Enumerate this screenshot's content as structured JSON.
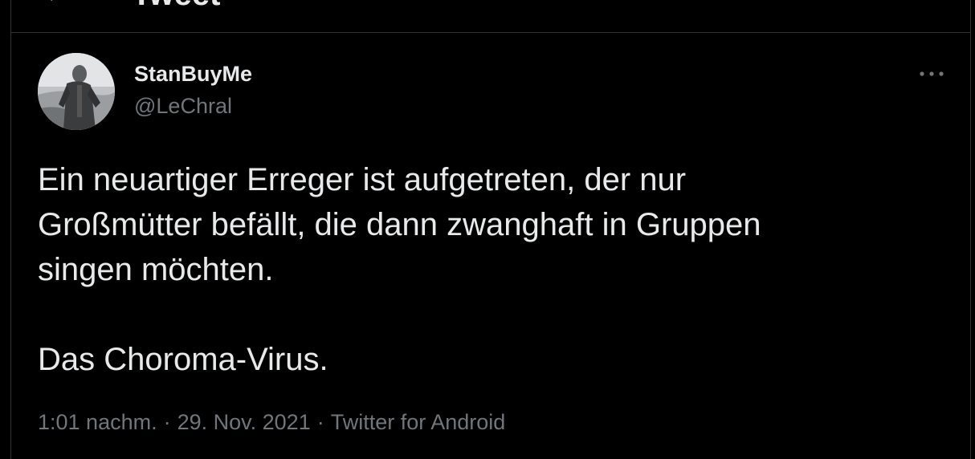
{
  "header": {
    "back_icon": "arrow-left-icon",
    "title": "Tweet"
  },
  "tweet": {
    "author": {
      "display_name": "StanBuyMe",
      "handle": "@LeChral",
      "avatar_icon": "profile-photo"
    },
    "more_icon": "ellipsis-icon",
    "text": "Ein neuartiger Erreger ist aufgetreten, der nur\nGroßmütter befällt, die dann zwanghaft in Gruppen\nsingen möchten.\n\nDas Choroma-Virus.",
    "time": "1:01 nachm.",
    "separator": "·",
    "date": "29. Nov. 2021",
    "source": "Twitter for Android"
  },
  "colors": {
    "background": "#000000",
    "text_primary": "#e7e9ea",
    "text_secondary": "#71767b",
    "border": "#2f3336"
  }
}
